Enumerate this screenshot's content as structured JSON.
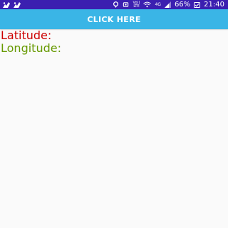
{
  "status_bar": {
    "left_icons": [
      "notification-icon",
      "notification-icon"
    ],
    "volte_label_top": "Vo))",
    "volte_label_bottom": "LTE",
    "network_label": "4G",
    "battery_percent": "66%",
    "time": "21:40"
  },
  "main": {
    "button_label": "CLICK HERE",
    "latitude_label": "Latitude:",
    "longitude_label": "Longitude:"
  },
  "colors": {
    "status_bar": "#3b1fb0",
    "button": "#3ab5e6",
    "latitude_text": "#cc0000",
    "longitude_text": "#669900",
    "background": "#fafafa"
  }
}
